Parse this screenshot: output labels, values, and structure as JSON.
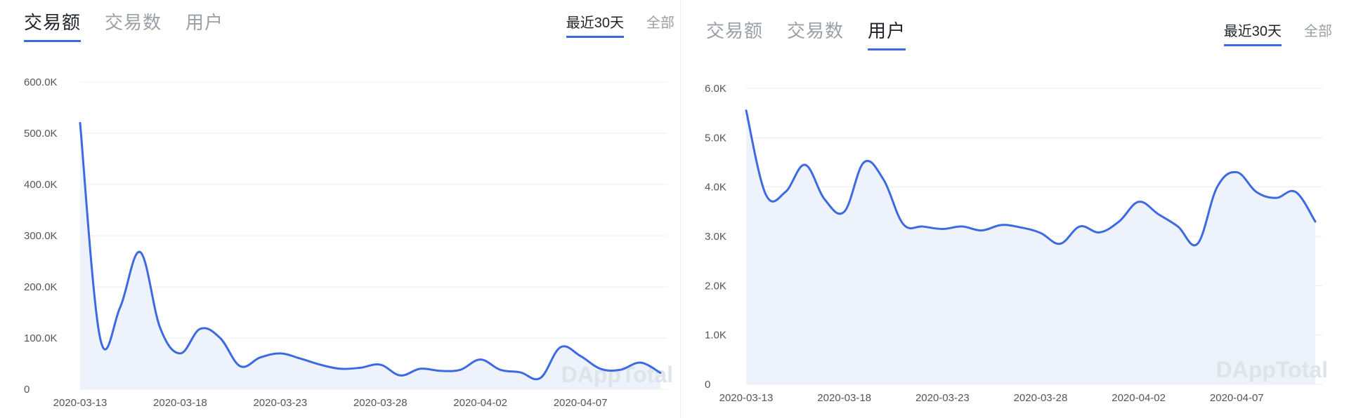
{
  "left": {
    "tabs": [
      {
        "label": "交易额",
        "active": true
      },
      {
        "label": "交易数",
        "active": false
      },
      {
        "label": "用户",
        "active": false
      }
    ],
    "range": [
      {
        "label": "最近30天",
        "active": true
      },
      {
        "label": "全部",
        "active": false
      }
    ],
    "watermark": "DAppTotal"
  },
  "right": {
    "tabs": [
      {
        "label": "交易额",
        "active": false
      },
      {
        "label": "交易数",
        "active": false
      },
      {
        "label": "用户",
        "active": true
      }
    ],
    "range": [
      {
        "label": "最近30天",
        "active": true
      },
      {
        "label": "全部",
        "active": false
      }
    ],
    "watermark": "DAppTotal"
  },
  "colors": {
    "line": "#3c6ae0",
    "area": "#eef2fb",
    "grid": "#ececec",
    "active_underline": "#3c6ae0"
  },
  "chart_data": [
    {
      "type": "area",
      "title": "",
      "xlabel": "",
      "ylabel": "",
      "x": [
        "2020-03-13",
        "2020-03-14",
        "2020-03-15",
        "2020-03-16",
        "2020-03-17",
        "2020-03-18",
        "2020-03-19",
        "2020-03-20",
        "2020-03-21",
        "2020-03-22",
        "2020-03-23",
        "2020-03-24",
        "2020-03-25",
        "2020-03-26",
        "2020-03-27",
        "2020-03-28",
        "2020-03-29",
        "2020-03-30",
        "2020-03-31",
        "2020-04-01",
        "2020-04-02",
        "2020-04-03",
        "2020-04-04",
        "2020-04-05",
        "2020-04-06",
        "2020-04-07",
        "2020-04-08",
        "2020-04-09",
        "2020-04-10",
        "2020-04-11"
      ],
      "x_ticks": [
        "2020-03-13",
        "2020-03-18",
        "2020-03-23",
        "2020-03-28",
        "2020-04-02",
        "2020-04-07"
      ],
      "y_ticks": [
        "0",
        "100.0K",
        "200.0K",
        "300.0K",
        "400.0K",
        "500.0K",
        "600.0K"
      ],
      "ylim": [
        0,
        600000
      ],
      "grid": true,
      "series": [
        {
          "values": [
            520000,
            100000,
            160000,
            268000,
            120000,
            70000,
            118000,
            100000,
            45000,
            62000,
            70000,
            60000,
            48000,
            40000,
            42000,
            48000,
            27000,
            40000,
            36000,
            38000,
            58000,
            38000,
            33000,
            22000,
            82000,
            65000,
            40000,
            38000,
            52000,
            32000
          ]
        }
      ]
    },
    {
      "type": "area",
      "title": "",
      "xlabel": "",
      "ylabel": "",
      "x": [
        "2020-03-13",
        "2020-03-14",
        "2020-03-15",
        "2020-03-16",
        "2020-03-17",
        "2020-03-18",
        "2020-03-19",
        "2020-03-20",
        "2020-03-21",
        "2020-03-22",
        "2020-03-23",
        "2020-03-24",
        "2020-03-25",
        "2020-03-26",
        "2020-03-27",
        "2020-03-28",
        "2020-03-29",
        "2020-03-30",
        "2020-03-31",
        "2020-04-01",
        "2020-04-02",
        "2020-04-03",
        "2020-04-04",
        "2020-04-05",
        "2020-04-06",
        "2020-04-07",
        "2020-04-08",
        "2020-04-09",
        "2020-04-10",
        "2020-04-11"
      ],
      "x_ticks": [
        "2020-03-13",
        "2020-03-18",
        "2020-03-23",
        "2020-03-28",
        "2020-04-02",
        "2020-04-07"
      ],
      "y_ticks": [
        "0",
        "1.0K",
        "2.0K",
        "3.0K",
        "4.0K",
        "5.0K",
        "6.0K"
      ],
      "ylim": [
        0,
        6000
      ],
      "grid": true,
      "series": [
        {
          "values": [
            5550,
            3850,
            3900,
            4450,
            3750,
            3500,
            4500,
            4150,
            3250,
            3200,
            3150,
            3200,
            3120,
            3230,
            3180,
            3070,
            2850,
            3200,
            3080,
            3300,
            3700,
            3450,
            3200,
            2850,
            4000,
            4300,
            3900,
            3780,
            3900,
            3300
          ]
        }
      ]
    }
  ]
}
